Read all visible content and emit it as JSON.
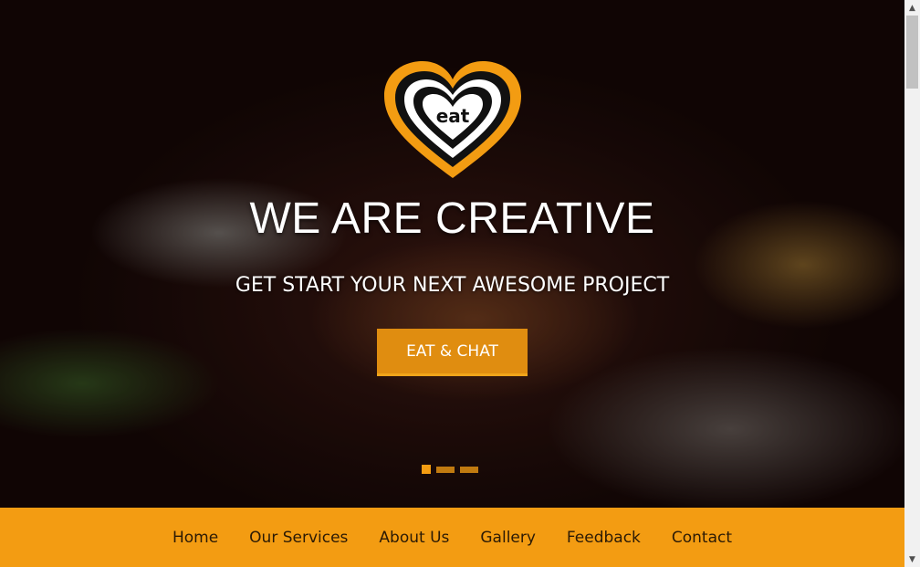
{
  "hero": {
    "logo_text": "eat",
    "headline": "WE ARE CREATIVE",
    "subheadline": "GET START YOUR NEXT AWESOME PROJECT",
    "cta_label": "EAT & CHAT",
    "slide_count": 3,
    "active_slide": 1
  },
  "nav": {
    "items": [
      "Home",
      "Our Services",
      "About Us",
      "Gallery",
      "Feedback",
      "Contact"
    ]
  },
  "colors": {
    "accent": "#f39c12",
    "cta": "#e08d10"
  },
  "icons": {
    "logo": "heart-logo-icon",
    "scroll_up": "triangle-up-icon",
    "scroll_down": "triangle-down-icon"
  }
}
